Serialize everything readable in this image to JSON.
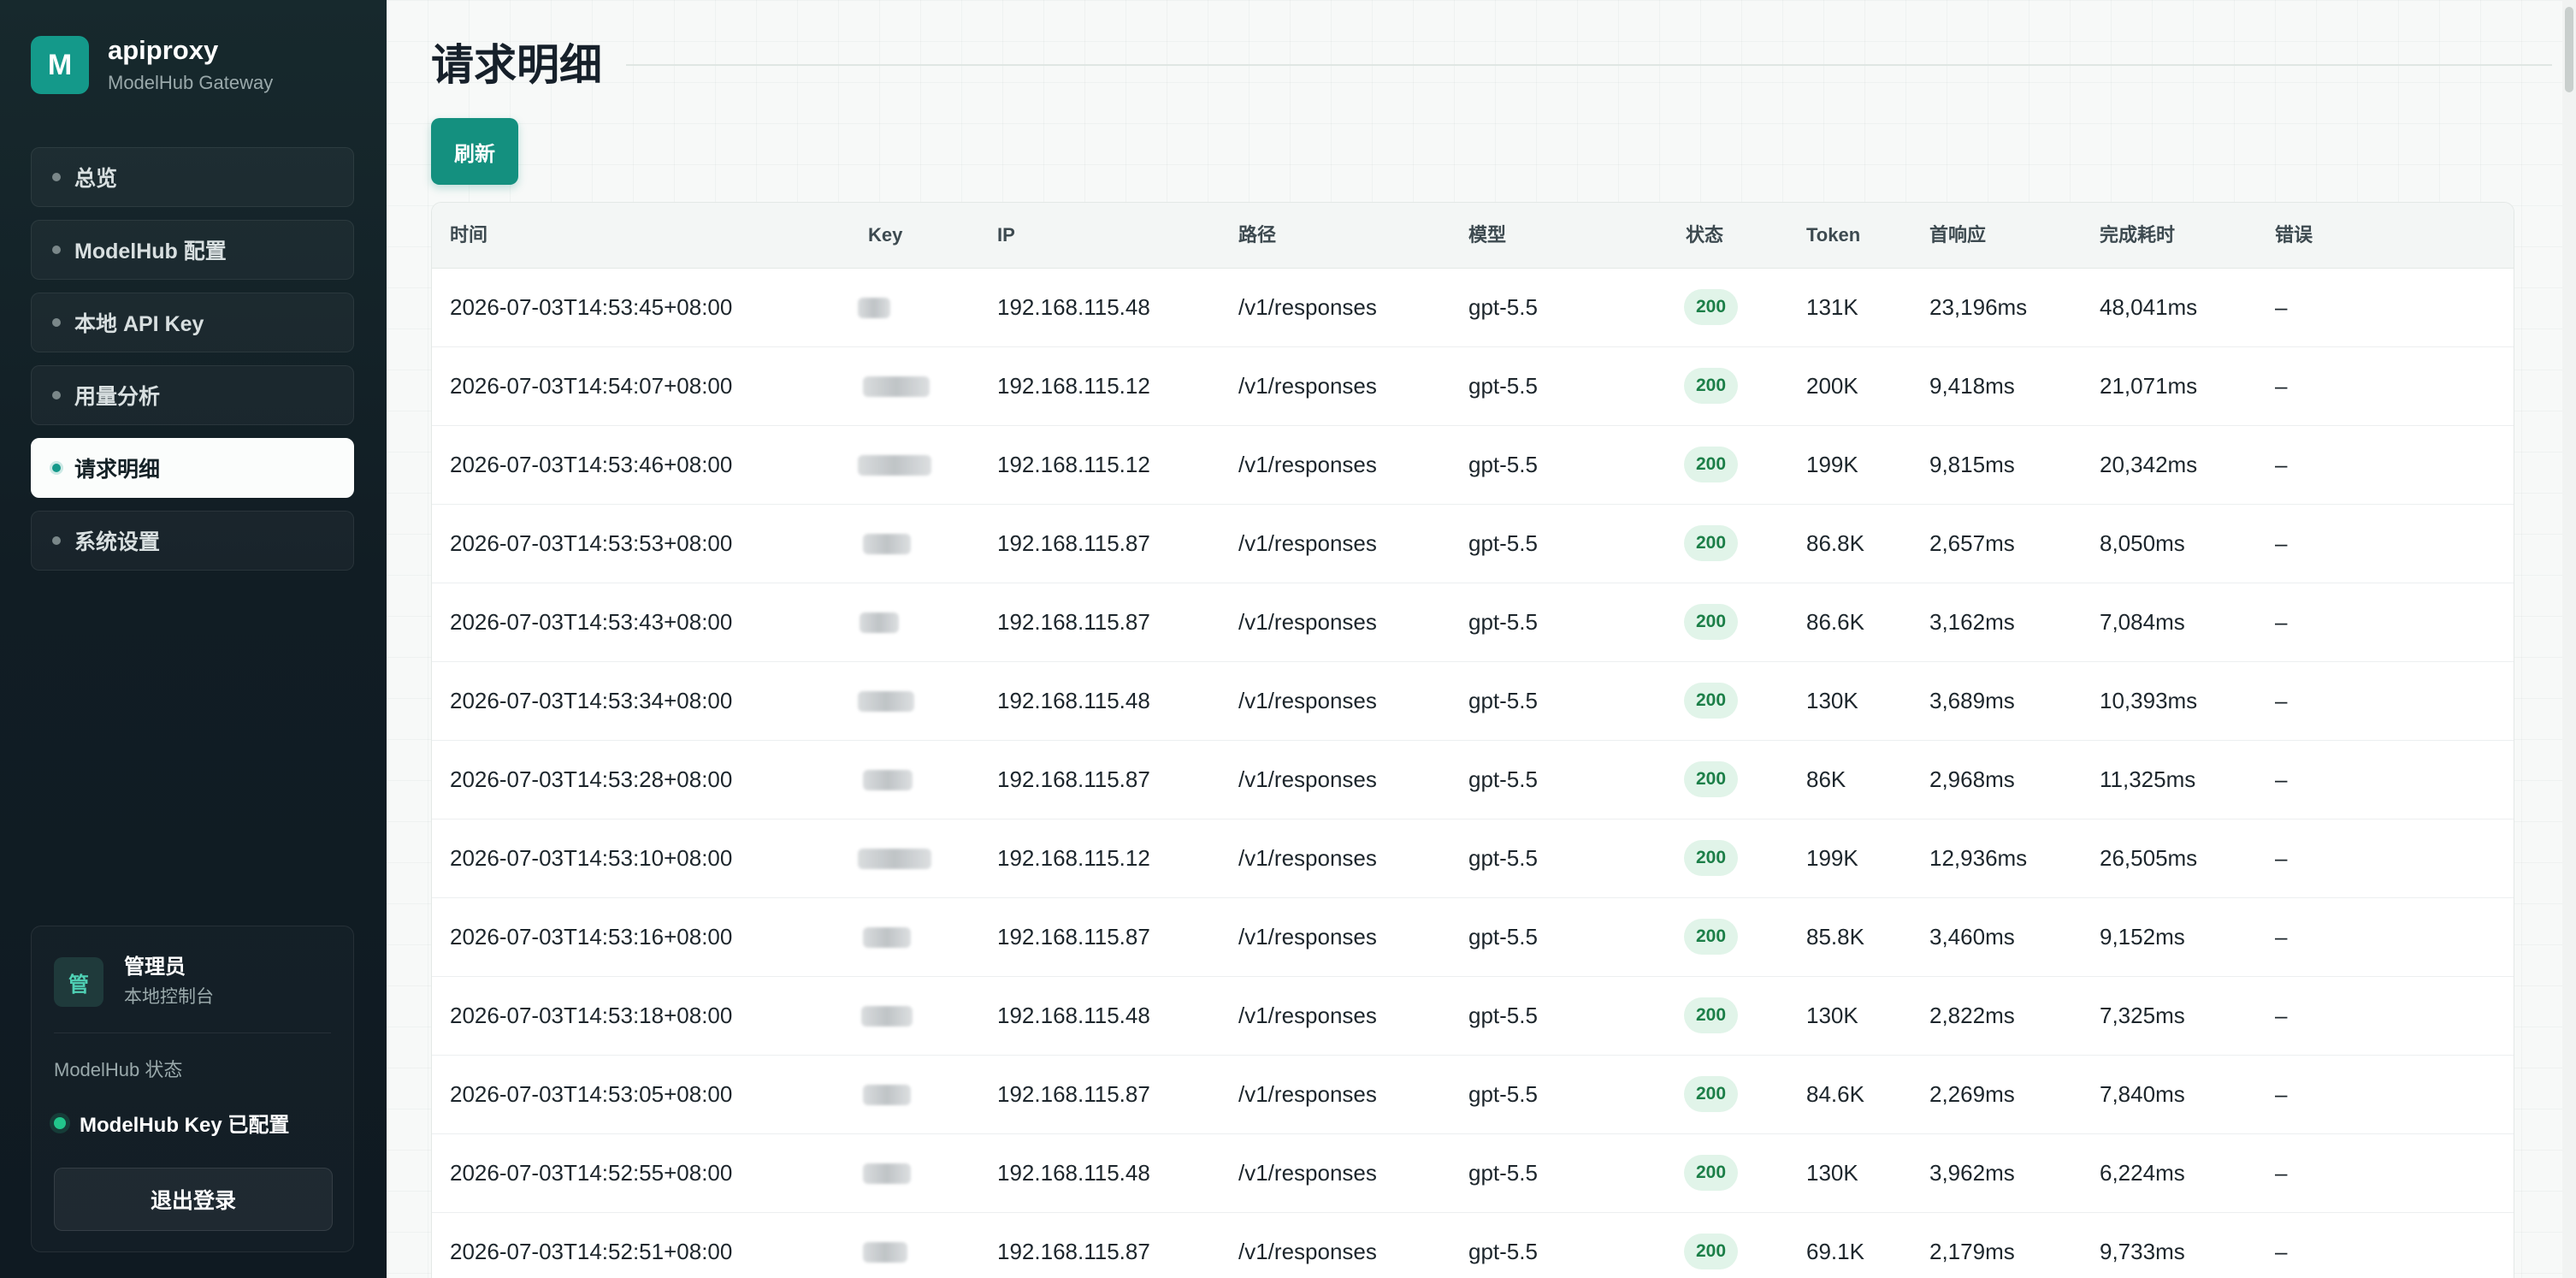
{
  "app": {
    "logo_letter": "M",
    "name": "apiproxy",
    "subtitle": "ModelHub Gateway",
    "accent_color": "#14998a"
  },
  "sidebar": {
    "items": [
      {
        "label": "总览",
        "active": false
      },
      {
        "label": "ModelHub 配置",
        "active": false
      },
      {
        "label": "本地 API Key",
        "active": false
      },
      {
        "label": "用量分析",
        "active": false
      },
      {
        "label": "请求明细",
        "active": true
      },
      {
        "label": "系统设置",
        "active": false
      }
    ]
  },
  "user": {
    "avatar_letter": "管",
    "name": "管理员",
    "role": "本地控制台",
    "status_title": "ModelHub 状态",
    "status_text": "ModelHub Key 已配置",
    "status_color": "#22c58b",
    "logout_label": "退出登录"
  },
  "page": {
    "title": "请求明细",
    "refresh_label": "刷新"
  },
  "table": {
    "columns": [
      "时间",
      "Key",
      "IP",
      "路径",
      "模型",
      "状态",
      "Token",
      "首响应",
      "完成耗时",
      "错误"
    ],
    "rows": [
      {
        "time": "2026-07-03T14:53:45+08:00",
        "ip": "192.168.115.48",
        "path": "/v1/responses",
        "model": "gpt-5.5",
        "status": "200",
        "token": "131K",
        "first": "23,196ms",
        "total": "48,041ms",
        "error": "–"
      },
      {
        "time": "2026-07-03T14:54:07+08:00",
        "ip": "192.168.115.12",
        "path": "/v1/responses",
        "model": "gpt-5.5",
        "status": "200",
        "token": "200K",
        "first": "9,418ms",
        "total": "21,071ms",
        "error": "–"
      },
      {
        "time": "2026-07-03T14:53:46+08:00",
        "ip": "192.168.115.12",
        "path": "/v1/responses",
        "model": "gpt-5.5",
        "status": "200",
        "token": "199K",
        "first": "9,815ms",
        "total": "20,342ms",
        "error": "–"
      },
      {
        "time": "2026-07-03T14:53:53+08:00",
        "ip": "192.168.115.87",
        "path": "/v1/responses",
        "model": "gpt-5.5",
        "status": "200",
        "token": "86.8K",
        "first": "2,657ms",
        "total": "8,050ms",
        "error": "–"
      },
      {
        "time": "2026-07-03T14:53:43+08:00",
        "ip": "192.168.115.87",
        "path": "/v1/responses",
        "model": "gpt-5.5",
        "status": "200",
        "token": "86.6K",
        "first": "3,162ms",
        "total": "7,084ms",
        "error": "–"
      },
      {
        "time": "2026-07-03T14:53:34+08:00",
        "ip": "192.168.115.48",
        "path": "/v1/responses",
        "model": "gpt-5.5",
        "status": "200",
        "token": "130K",
        "first": "3,689ms",
        "total": "10,393ms",
        "error": "–"
      },
      {
        "time": "2026-07-03T14:53:28+08:00",
        "ip": "192.168.115.87",
        "path": "/v1/responses",
        "model": "gpt-5.5",
        "status": "200",
        "token": "86K",
        "first": "2,968ms",
        "total": "11,325ms",
        "error": "–"
      },
      {
        "time": "2026-07-03T14:53:10+08:00",
        "ip": "192.168.115.12",
        "path": "/v1/responses",
        "model": "gpt-5.5",
        "status": "200",
        "token": "199K",
        "first": "12,936ms",
        "total": "26,505ms",
        "error": "–"
      },
      {
        "time": "2026-07-03T14:53:16+08:00",
        "ip": "192.168.115.87",
        "path": "/v1/responses",
        "model": "gpt-5.5",
        "status": "200",
        "token": "85.8K",
        "first": "3,460ms",
        "total": "9,152ms",
        "error": "–"
      },
      {
        "time": "2026-07-03T14:53:18+08:00",
        "ip": "192.168.115.48",
        "path": "/v1/responses",
        "model": "gpt-5.5",
        "status": "200",
        "token": "130K",
        "first": "2,822ms",
        "total": "7,325ms",
        "error": "–"
      },
      {
        "time": "2026-07-03T14:53:05+08:00",
        "ip": "192.168.115.87",
        "path": "/v1/responses",
        "model": "gpt-5.5",
        "status": "200",
        "token": "84.6K",
        "first": "2,269ms",
        "total": "7,840ms",
        "error": "–"
      },
      {
        "time": "2026-07-03T14:52:55+08:00",
        "ip": "192.168.115.48",
        "path": "/v1/responses",
        "model": "gpt-5.5",
        "status": "200",
        "token": "130K",
        "first": "3,962ms",
        "total": "6,224ms",
        "error": "–"
      },
      {
        "time": "2026-07-03T14:52:51+08:00",
        "ip": "192.168.115.87",
        "path": "/v1/responses",
        "model": "gpt-5.5",
        "status": "200",
        "token": "69.1K",
        "first": "2,179ms",
        "total": "9,733ms",
        "error": "–"
      }
    ]
  }
}
